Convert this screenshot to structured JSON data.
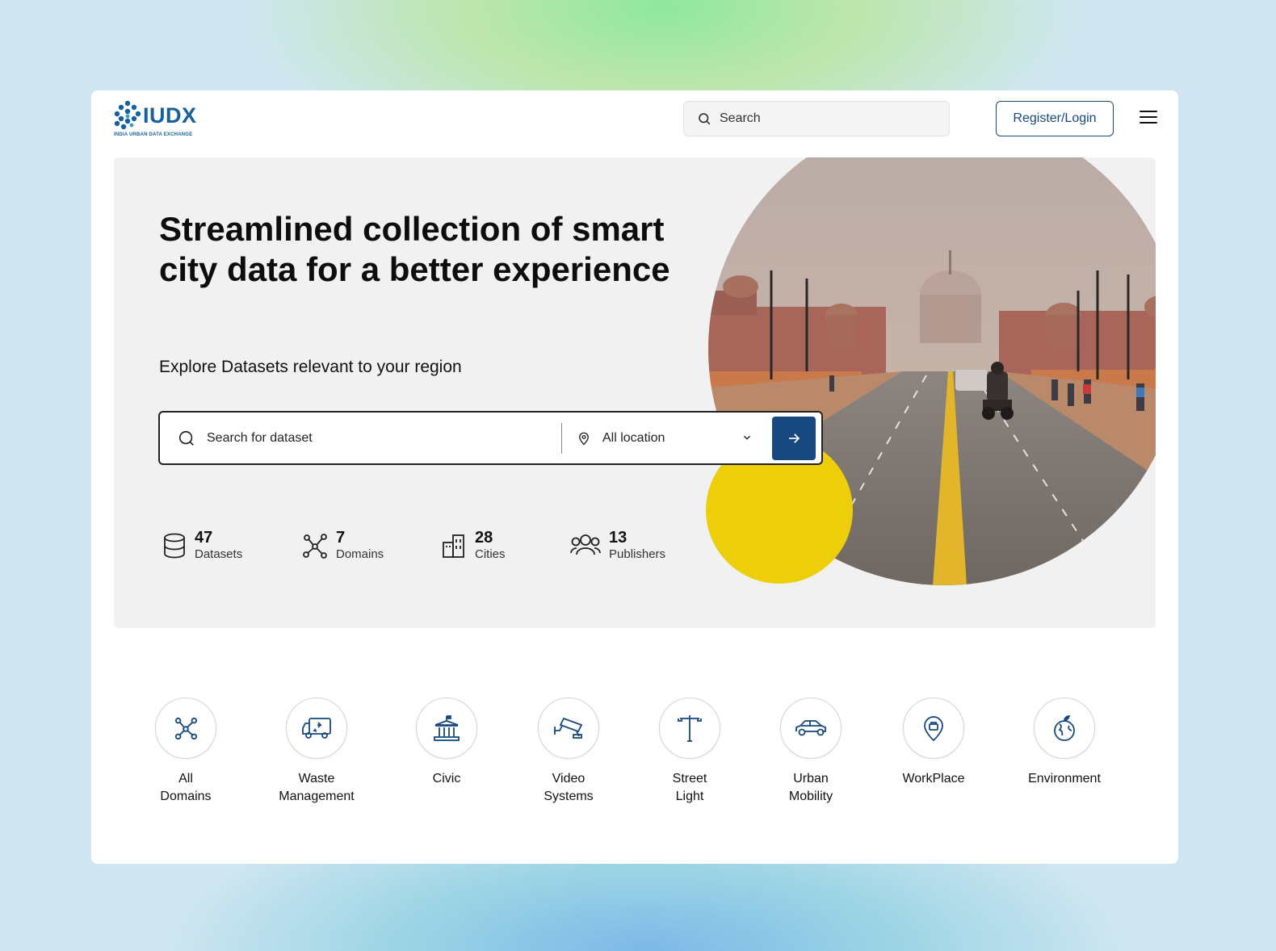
{
  "header": {
    "logo_text": "IUDX",
    "logo_subtitle": "INDIA URBAN DATA EXCHANGE",
    "search_placeholder": "Search",
    "register_label": "Register/Login"
  },
  "hero": {
    "title": "Streamlined collection of smart city data for a better experience",
    "subtitle": "Explore Datasets relevant to your region",
    "search_placeholder": "Search for dataset",
    "location_value": "All location"
  },
  "stats": [
    {
      "value": "47",
      "label": "Datasets",
      "icon": "database-icon"
    },
    {
      "value": "7",
      "label": "Domains",
      "icon": "network-icon"
    },
    {
      "value": "28",
      "label": "Cities",
      "icon": "buildings-icon"
    },
    {
      "value": "13",
      "label": "Publishers",
      "icon": "people-icon"
    }
  ],
  "domains": [
    {
      "label_1": "All",
      "label_2": "Domains",
      "icon": "network-icon"
    },
    {
      "label_1": "Waste",
      "label_2": "Management",
      "icon": "garbage-truck-icon"
    },
    {
      "label_1": "Civic",
      "label_2": "",
      "icon": "civic-building-icon"
    },
    {
      "label_1": "Video",
      "label_2": "Systems",
      "icon": "cctv-icon"
    },
    {
      "label_1": "Street",
      "label_2": "Light",
      "icon": "street-light-icon"
    },
    {
      "label_1": "Urban",
      "label_2": "Mobility",
      "icon": "car-icon"
    },
    {
      "label_1": "WorkPlace",
      "label_2": "",
      "icon": "workplace-pin-icon"
    },
    {
      "label_1": "Environment",
      "label_2": "",
      "icon": "globe-leaf-icon"
    }
  ],
  "colors": {
    "brand_blue": "#17497f",
    "accent_yellow": "#ecce0b",
    "hero_bg": "#f1f1f1"
  }
}
